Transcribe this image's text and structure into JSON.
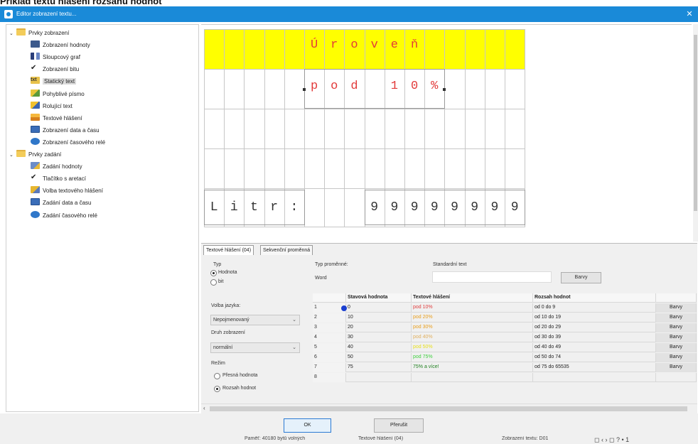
{
  "caption": "Příklad textu hlášení rozsahu hodnot",
  "window": {
    "title": "Editor zobrazení textu...",
    "close_glyph": "✕"
  },
  "tree": {
    "groups": [
      {
        "label": "Prvky zobrazení",
        "icon": "folder-icon"
      },
      {
        "label": "Prvky zadání",
        "icon": "folder-icon"
      }
    ],
    "display_items": [
      {
        "label": "Zobrazení hodnoty",
        "icon": "numeric-display-icon"
      },
      {
        "label": "Sloupcový graf",
        "icon": "bar-graph-icon"
      },
      {
        "label": "Zobrazení bitu",
        "icon": "checkmark-icon"
      },
      {
        "label": "Statický text",
        "icon": "static-text-icon",
        "selected": true
      },
      {
        "label": "Pohyblivé písmo",
        "icon": "moving-text-icon"
      },
      {
        "label": "Rolující text",
        "icon": "scrolling-text-icon"
      },
      {
        "label": "Textové hlášení",
        "icon": "text-message-icon"
      },
      {
        "label": "Zobrazení data a času",
        "icon": "calendar-icon"
      },
      {
        "label": "Zobrazení časového relé",
        "icon": "timer-relay-icon"
      }
    ],
    "input_items": [
      {
        "label": "Zadání hodnoty",
        "icon": "value-input-icon"
      },
      {
        "label": "Tlačítko s aretací",
        "icon": "latch-button-icon"
      },
      {
        "label": "Volba textového hlášení",
        "icon": "message-select-icon"
      },
      {
        "label": "Zadání data a času",
        "icon": "date-input-icon"
      },
      {
        "label": "Zadání časového relé",
        "icon": "timer-input-icon"
      }
    ]
  },
  "canvas": {
    "row1_chars": [
      "Ú",
      "r",
      "o",
      "v",
      "e",
      "ň"
    ],
    "row2_chars": [
      "p",
      "o",
      "d",
      "",
      "1",
      "0",
      "%"
    ],
    "row5_left_chars": [
      "L",
      "i",
      "t",
      "r",
      ":"
    ],
    "row5_right_chars": [
      "9",
      "9",
      "9",
      "9",
      "9",
      "9",
      "9",
      "9"
    ],
    "highlight_color": "#ffff00",
    "text_red": "#e23a3a"
  },
  "props": {
    "tabs": [
      "Textové hlášení (04)",
      "Sekvenční proměnná"
    ],
    "typ_label": "Typ",
    "typ_options": [
      "Hodnota",
      "bit"
    ],
    "typ_selected": "Hodnota",
    "typ_promenne_label": "Typ proměnné:",
    "typ_promenne_value": "Word",
    "standard_text_label": "Standardní text",
    "barvy_label": "Barvy",
    "language_label": "Volba jazyka:",
    "language_value": "Nepojmenovaný",
    "display_type_label": "Druh zobrazení",
    "display_type_value": "normální",
    "mode_label": "Režim",
    "mode_options": [
      "Přesná hodnota",
      "Rozsah hodnot"
    ],
    "mode_selected": "Rozsah hodnot"
  },
  "table": {
    "headers": [
      "",
      "Stavová hodnota",
      "Textové hlášení",
      "Rozsah hodnot",
      ""
    ],
    "rows": [
      {
        "num": "1",
        "state": "0",
        "text": "pod 10%",
        "color": "#e04040",
        "range": "od 0 do 9",
        "btn": "Barvy"
      },
      {
        "num": "2",
        "state": "10",
        "text": "pod 20%",
        "color": "#e8a020",
        "range": "od 10 do 19",
        "btn": "Barvy"
      },
      {
        "num": "3",
        "state": "20",
        "text": "pod 30%",
        "color": "#e8a020",
        "range": "od 20 do 29",
        "btn": "Barvy"
      },
      {
        "num": "4",
        "state": "30",
        "text": "pod 40%",
        "color": "#e0b060",
        "range": "od 30 do 39",
        "btn": "Barvy"
      },
      {
        "num": "5",
        "state": "40",
        "text": "pod 50%",
        "color": "#e8e020",
        "range": "od 40 do 49",
        "btn": "Barvy"
      },
      {
        "num": "6",
        "state": "50",
        "text": "pod 75%",
        "color": "#40d040",
        "range": "od 50 do 74",
        "btn": "Barvy"
      },
      {
        "num": "7",
        "state": "75",
        "text": "75% a více!",
        "color": "#208020",
        "range": "od 75 do 65535",
        "btn": "Barvy"
      },
      {
        "num": "8",
        "state": "",
        "text": "",
        "color": "#222222",
        "range": "",
        "btn": ""
      }
    ]
  },
  "buttons": {
    "ok": "OK",
    "cancel": "Přerušit"
  },
  "status": {
    "left": "Paměť: 40180 bytů volných",
    "mid": "Textové hlášení (04)",
    "right": "Zobrazení textu: D01",
    "icons": "◻ ‹ › ◻ ? • 1"
  }
}
